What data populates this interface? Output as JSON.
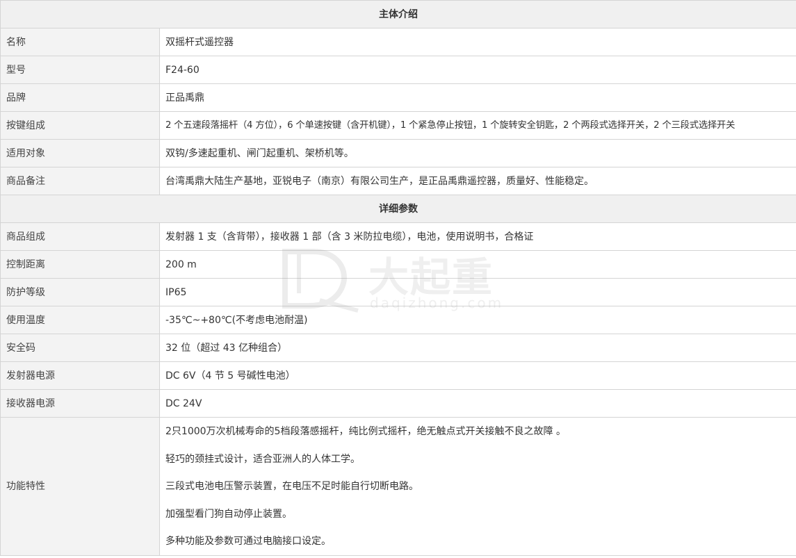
{
  "sections": [
    {
      "title": "主体介绍",
      "rows": [
        {
          "label": "名称",
          "value": "双摇杆式遥控器"
        },
        {
          "label": "型号",
          "value": "F24-60"
        },
        {
          "label": "品牌",
          "value": "正品禹鼎"
        },
        {
          "label": "按键组成",
          "value": "2 个五速段落摇杆（4 方位），6 个单速按键（含开机键），1 个紧急停止按钮，1 个旋转安全钥匙，2 个两段式选择开关，2 个三段式选择开关"
        },
        {
          "label": "适用对象",
          "value": "双钩/多速起重机、闸门起重机、架桥机等。"
        },
        {
          "label": "商品备注",
          "value": "台湾禹鼎大陆生产基地，亚锐电子（南京）有限公司生产，是正品禹鼎遥控器，质量好、性能稳定。"
        }
      ]
    },
    {
      "title": "详细参数",
      "rows": [
        {
          "label": "商品组成",
          "value": "发射器 1 支（含背带），接收器 1 部（含 3 米防拉电缆），电池，使用说明书，合格证"
        },
        {
          "label": "控制距离",
          "value": "200 m"
        },
        {
          "label": "防护等级",
          "value": "IP65"
        },
        {
          "label": "使用温度",
          "value": "-35℃~+80℃(不考虑电池耐温)"
        },
        {
          "label": "安全码",
          "value": "32 位（超过 43 亿种组合）"
        },
        {
          "label": "发射器电源",
          "value": "DC 6V（4 节 5 号碱性电池）"
        },
        {
          "label": "接收器电源",
          "value": "DC 24V"
        }
      ]
    }
  ],
  "features": {
    "label": "功能特性",
    "items": [
      "2只1000万次机械寿命的5档段落感摇杆，纯比例式摇杆，绝无触点式开关接触不良之故障 。",
      "轻巧的颈挂式设计，适合亚洲人的人体工学。",
      "三段式电池电压警示装置，在电压不足时能自行切断电路。",
      "加强型看门狗自动停止装置。",
      "多种功能及参数可通过电脑接口设定。"
    ]
  },
  "watermark": {
    "text_cn": "大起重",
    "text_en": "daqizhong.com"
  }
}
